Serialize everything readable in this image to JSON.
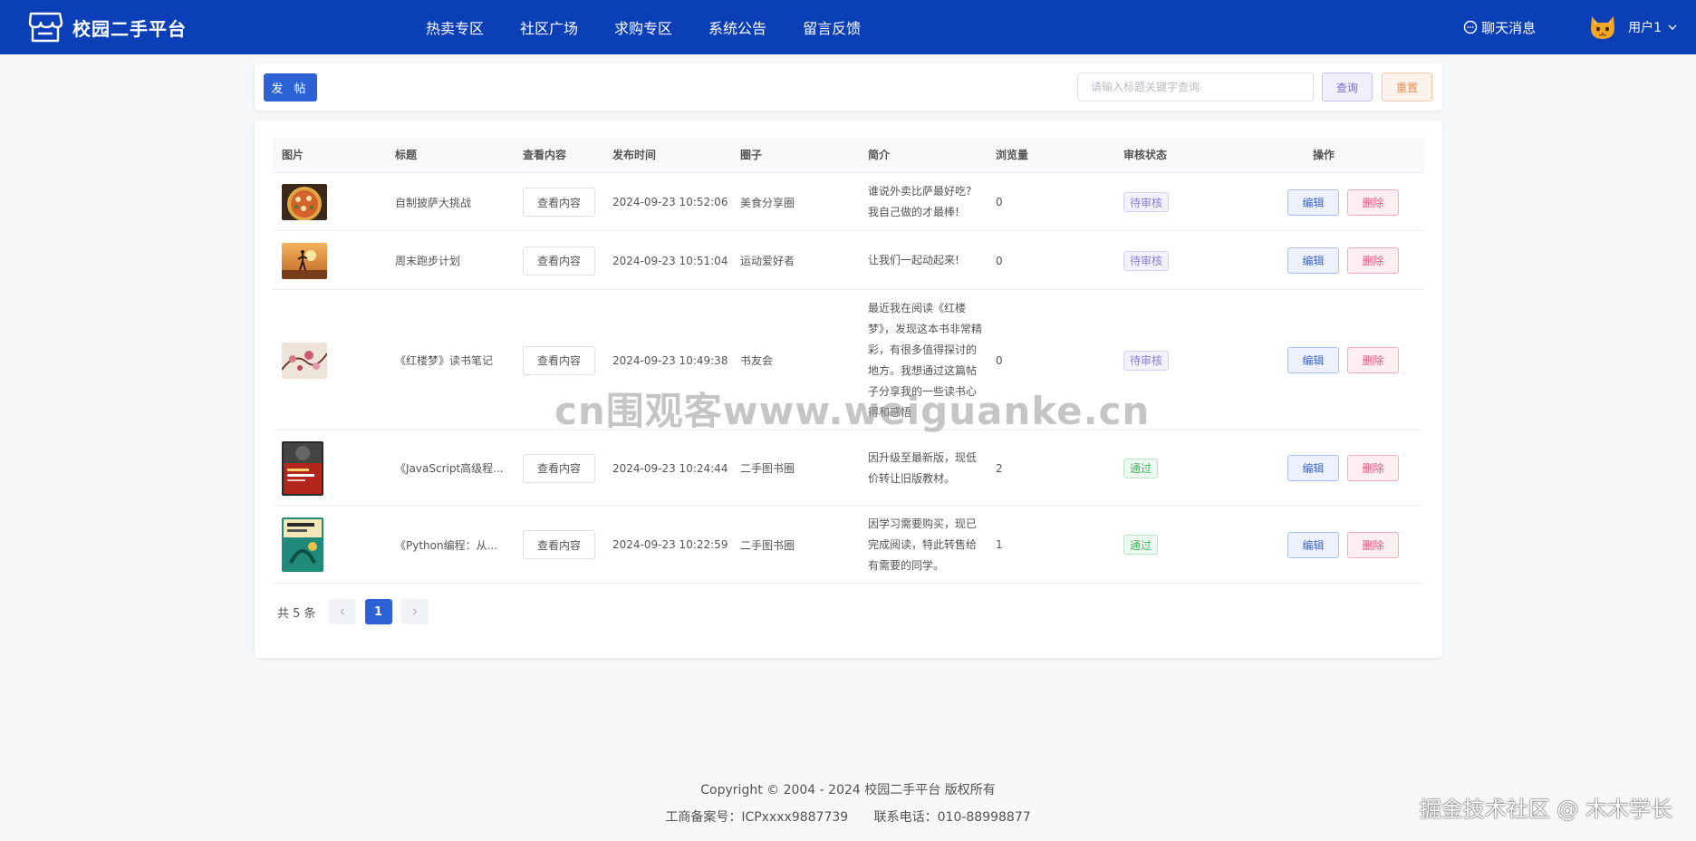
{
  "header": {
    "app_title": "校园二手平台",
    "nav": [
      "热卖专区",
      "社区广场",
      "求购专区",
      "系统公告",
      "留言反馈"
    ],
    "chat_label": "聊天消息",
    "user_name": "用户1",
    "bg_color": "#0a3fb8"
  },
  "toolbar": {
    "post_label": "发 帖",
    "search_placeholder": "请输入标题关键字查询",
    "search_value": "",
    "query_label": "查询",
    "reset_label": "重置"
  },
  "table": {
    "columns": [
      "图片",
      "标题",
      "查看内容",
      "发布时间",
      "圈子",
      "简介",
      "浏览量",
      "审核状态",
      "操作"
    ],
    "rows": [
      {
        "image": "pizza-photo",
        "title": "自制披萨大挑战",
        "view_label": "查看内容",
        "time": "2024-09-23 10:52:06",
        "circle": "美食分享圈",
        "intro": "谁说外卖比萨最好吃?我自己做的才最棒!",
        "views": "0",
        "status": "待审核",
        "edit": "编辑",
        "delete": "删除"
      },
      {
        "image": "running-photo",
        "title": "周末跑步计划",
        "view_label": "查看内容",
        "time": "2024-09-23 10:51:04",
        "circle": "运动爱好者",
        "intro": "让我们一起动起来!",
        "views": "0",
        "status": "待审核",
        "edit": "编辑",
        "delete": "删除"
      },
      {
        "image": "painting-photo",
        "title": "《红楼梦》读书笔记",
        "view_label": "查看内容",
        "time": "2024-09-23 10:49:38",
        "circle": "书友会",
        "intro": "最近我在阅读《红楼梦》，发现这本书非常精彩，有很多值得探讨的地方。我想通过这篇帖子分享我的一些读书心得和感悟",
        "views": "0",
        "status": "待审核",
        "edit": "编辑",
        "delete": "删除"
      },
      {
        "image": "js-book-cover",
        "title": "《JavaScript高级程...",
        "view_label": "查看内容",
        "time": "2024-09-23 10:24:44",
        "circle": "二手图书圈",
        "intro": "因升级至最新版，现低价转让旧版教材。",
        "views": "2",
        "status": "通过",
        "edit": "编辑",
        "delete": "删除"
      },
      {
        "image": "python-book-cover",
        "title": "《Python编程：从...",
        "view_label": "查看内容",
        "time": "2024-09-23 10:22:59",
        "circle": "二手图书圈",
        "intro": "因学习需要购买，现已完成阅读，特此转售给有需要的同学。",
        "views": "1",
        "status": "通过",
        "edit": "编辑",
        "delete": "删除"
      }
    ]
  },
  "pagination": {
    "total_label": "共 5 条",
    "current_page": "1",
    "prev_icon": "chevron-left-icon",
    "next_icon": "chevron-right-icon"
  },
  "watermark": "cn围观客www.weiguanke.cn",
  "footer": {
    "copyright": "Copyright © 2004 - 2024 校园二手平台 版权所有",
    "icp": "工商备案号：ICPxxxx9887739",
    "phone": "联系电话：010-88998877"
  },
  "corner_mark": "掘金技术社区 @ 木木学长"
}
